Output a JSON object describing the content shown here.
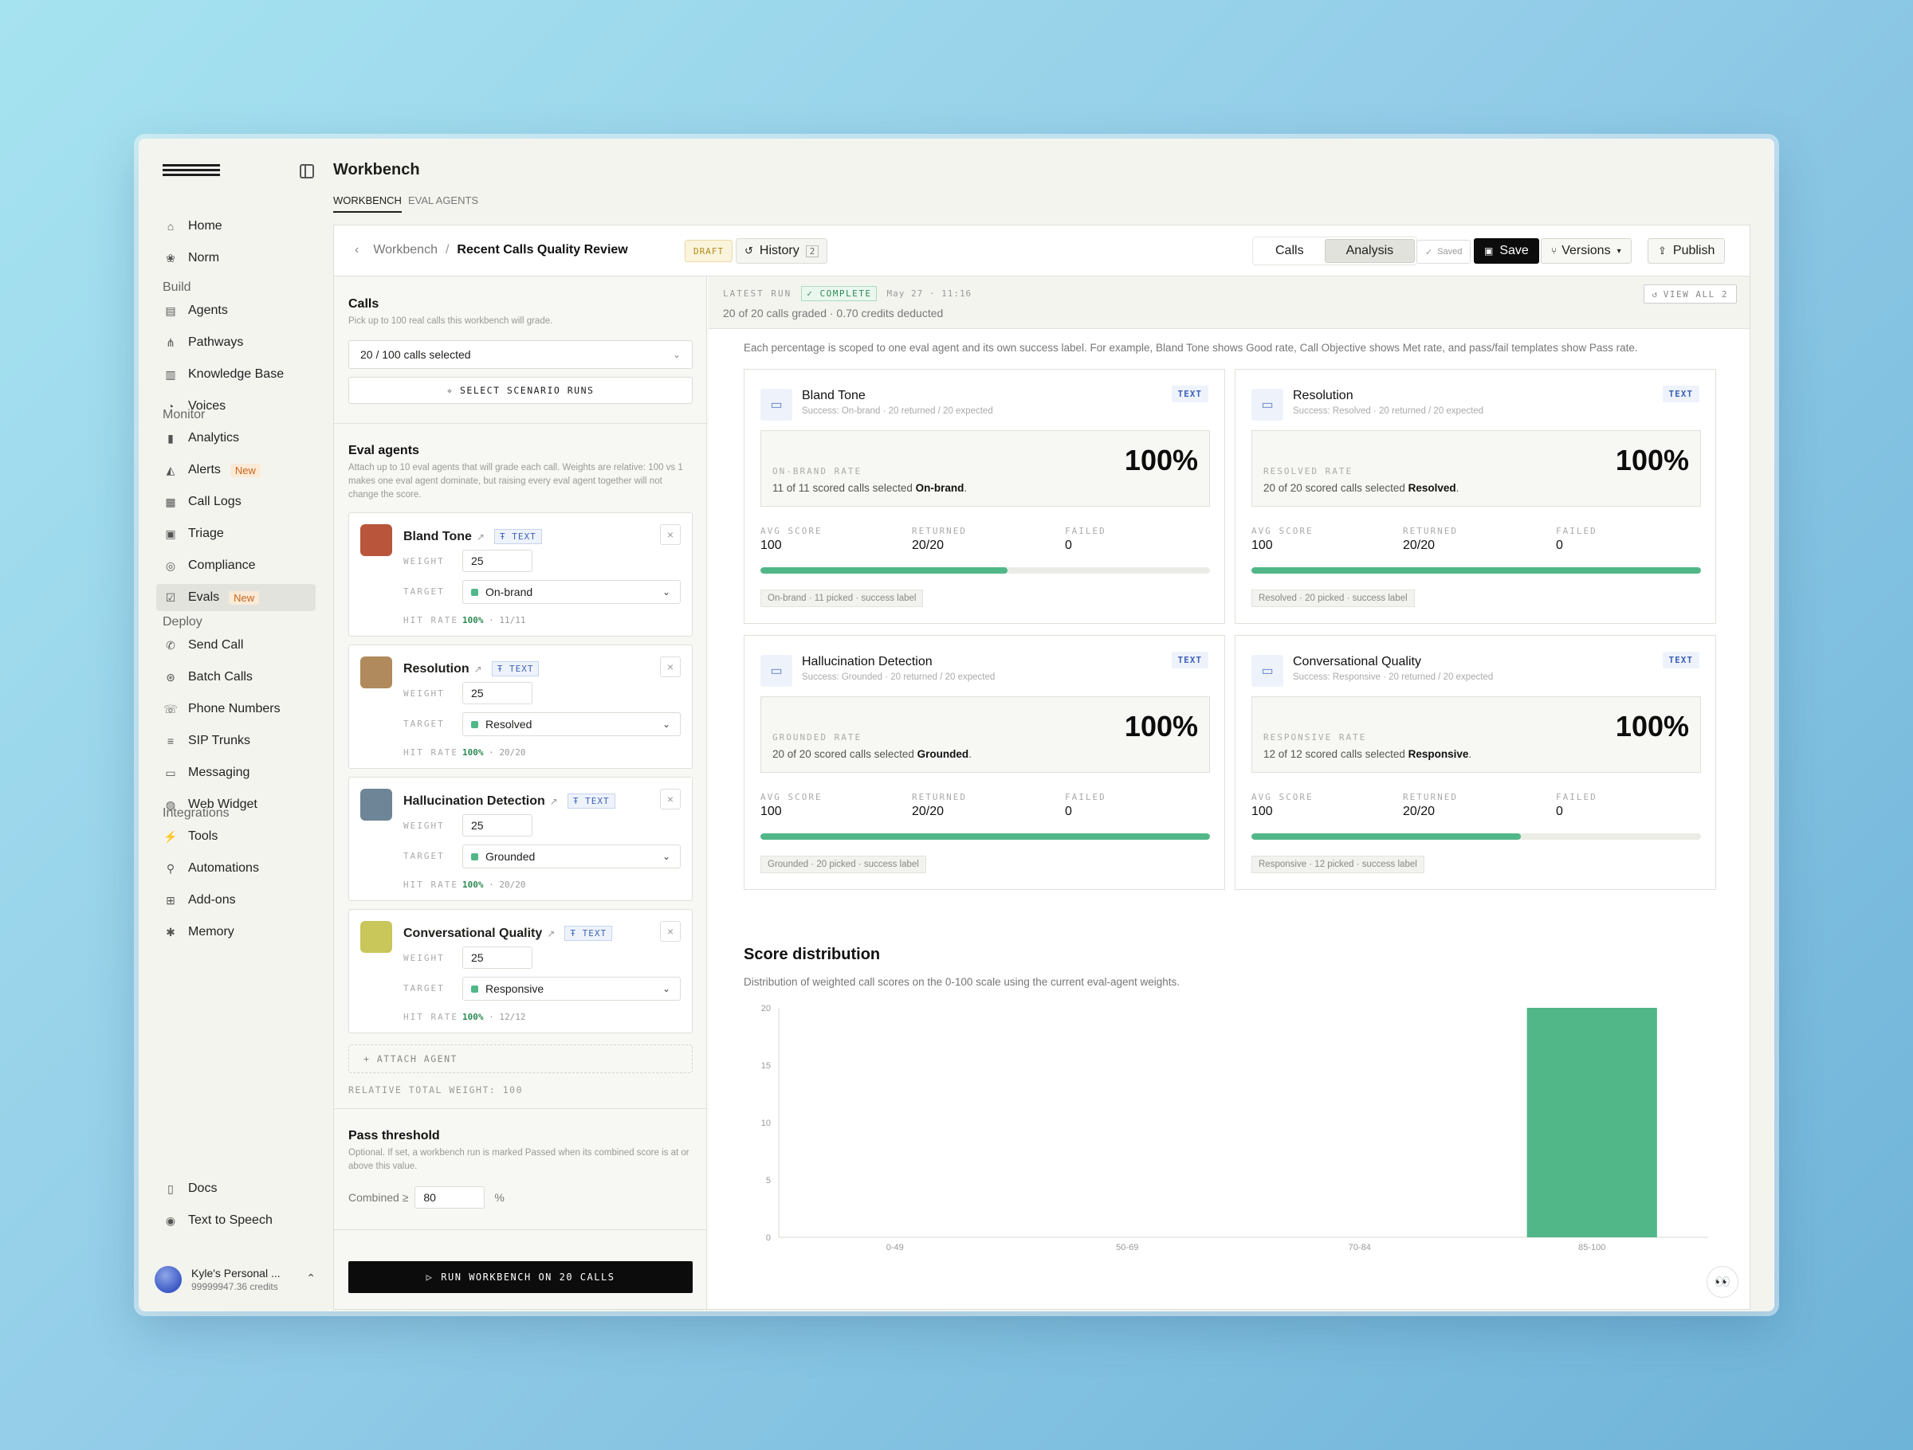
{
  "sidebar": {
    "items": [
      {
        "label": "Home",
        "icon": "home-icon"
      },
      {
        "label": "Norm",
        "icon": "norm-icon"
      }
    ],
    "sections": [
      {
        "title": "Build",
        "items": [
          {
            "label": "Agents"
          },
          {
            "label": "Pathways"
          },
          {
            "label": "Knowledge Base"
          },
          {
            "label": "Voices"
          }
        ]
      },
      {
        "title": "Monitor",
        "items": [
          {
            "label": "Analytics"
          },
          {
            "label": "Alerts",
            "badge": "New"
          },
          {
            "label": "Call Logs"
          },
          {
            "label": "Triage"
          },
          {
            "label": "Compliance"
          },
          {
            "label": "Evals",
            "badge": "New"
          }
        ]
      },
      {
        "title": "Deploy",
        "items": [
          {
            "label": "Send Call"
          },
          {
            "label": "Batch Calls"
          },
          {
            "label": "Phone Numbers"
          },
          {
            "label": "SIP Trunks"
          },
          {
            "label": "Messaging"
          },
          {
            "label": "Web Widget"
          }
        ]
      },
      {
        "title": "Integrations",
        "items": [
          {
            "label": "Tools"
          },
          {
            "label": "Automations"
          },
          {
            "label": "Add-ons"
          },
          {
            "label": "Memory"
          }
        ]
      }
    ],
    "bottom": [
      {
        "label": "Docs"
      },
      {
        "label": "Text to Speech"
      }
    ],
    "user": {
      "name": "Kyle's Personal ...",
      "credits": "99999947.36 credits"
    }
  },
  "header": {
    "title": "Workbench",
    "tabs": [
      {
        "label": "WORKBENCH"
      },
      {
        "label": "EVAL AGENTS"
      }
    ]
  },
  "topbar": {
    "crumb_parent": "Workbench",
    "crumb_sep": "/",
    "crumb_current": "Recent Calls Quality Review",
    "draft": "DRAFT",
    "history_label": "History",
    "history_count": "2",
    "seg_calls": "Calls",
    "seg_analysis": "Analysis",
    "saved": "Saved",
    "save": "Save",
    "versions": "Versions",
    "publish": "Publish"
  },
  "calls": {
    "title": "Calls",
    "sub": "Pick up to 100 real calls this workbench will grade.",
    "selected": "20 / 100 calls selected",
    "scenario_btn": "SELECT SCENARIO RUNS"
  },
  "eval_agents": {
    "title": "Eval agents",
    "sub": "Attach up to 10 eval agents that will grade each call. Weights are relative: 100 vs 1 makes one eval agent dominate, but raising every eval agent together will not change the score.",
    "weight_label": "WEIGHT",
    "target_label": "TARGET",
    "hitrate_label": "HIT RATE",
    "text_tag": "TEXT",
    "agents": [
      {
        "name": "Bland Tone",
        "weight": "25",
        "target": "On-brand",
        "hit": "100%",
        "hit_frac": "· 11/11",
        "color": "#b8553a"
      },
      {
        "name": "Resolution",
        "weight": "25",
        "target": "Resolved",
        "hit": "100%",
        "hit_frac": "· 20/20",
        "color": "#b08a5c"
      },
      {
        "name": "Hallucination Detection",
        "weight": "25",
        "target": "Grounded",
        "hit": "100%",
        "hit_frac": "· 20/20",
        "color": "#6d8596"
      },
      {
        "name": "Conversational Quality",
        "weight": "25",
        "target": "Responsive",
        "hit": "100%",
        "hit_frac": "· 12/12",
        "color": "#c9c65a"
      }
    ],
    "attach": "+ ATTACH AGENT",
    "relative_total": "RELATIVE TOTAL WEIGHT: 100"
  },
  "threshold": {
    "title": "Pass threshold",
    "sub": "Optional. If set, a workbench run is marked Passed when its combined score is at or above this value.",
    "label": "Combined ≥",
    "value": "80",
    "unit": "%"
  },
  "run_button": "RUN WORKBENCH ON 20 CALLS",
  "latest_run": {
    "label": "LATEST RUN",
    "status": "COMPLETE",
    "date": "May 27 · 11:16",
    "summary": "20 of 20 calls graded · 0.70 credits deducted",
    "view_all": "VIEW ALL 2"
  },
  "scope_note": "Each percentage is scoped to one eval agent and its own success label. For example, Bland Tone shows Good rate, Call Objective shows Met rate, and pass/fail templates show Pass rate.",
  "metric_labels": {
    "avg": "AVG SCORE",
    "returned": "RETURNED",
    "failed": "FAILED"
  },
  "cards": [
    {
      "title": "Bland Tone",
      "tag": "TEXT",
      "sub": "Success: On-brand · 20 returned / 20 expected",
      "rate_label": "ON-BRAND RATE",
      "rate": "100%",
      "rate_pre": "11 of 11 scored calls selected ",
      "rate_bold": "On-brand",
      "rate_post": ".",
      "avg": "100",
      "returned": "20/20",
      "failed": "0",
      "progress": 0.55,
      "foot": "On-brand · 11 picked · success label"
    },
    {
      "title": "Resolution",
      "tag": "TEXT",
      "sub": "Success: Resolved · 20 returned / 20 expected",
      "rate_label": "RESOLVED RATE",
      "rate": "100%",
      "rate_pre": "20 of 20 scored calls selected ",
      "rate_bold": "Resolved",
      "rate_post": ".",
      "avg": "100",
      "returned": "20/20",
      "failed": "0",
      "progress": 1.0,
      "foot": "Resolved · 20 picked · success label"
    },
    {
      "title": "Hallucination Detection",
      "tag": "TEXT",
      "sub": "Success: Grounded · 20 returned / 20 expected",
      "rate_label": "GROUNDED RATE",
      "rate": "100%",
      "rate_pre": "20 of 20 scored calls selected ",
      "rate_bold": "Grounded",
      "rate_post": ".",
      "avg": "100",
      "returned": "20/20",
      "failed": "0",
      "progress": 1.0,
      "foot": "Grounded · 20 picked · success label"
    },
    {
      "title": "Conversational Quality",
      "tag": "TEXT",
      "sub": "Success: Responsive · 20 returned / 20 expected",
      "rate_label": "RESPONSIVE RATE",
      "rate": "100%",
      "rate_pre": "12 of 12 scored calls selected ",
      "rate_bold": "Responsive",
      "rate_post": ".",
      "avg": "100",
      "returned": "20/20",
      "failed": "0",
      "progress": 0.6,
      "foot": "Responsive · 12 picked · success label"
    }
  ],
  "score_dist": {
    "title": "Score distribution",
    "sub": "Distribution of weighted call scores on the 0-100 scale using the current eval-agent weights."
  },
  "chart_data": {
    "type": "bar",
    "categories": [
      "0-49",
      "50-69",
      "70-84",
      "85-100"
    ],
    "values": [
      0,
      0,
      0,
      20
    ],
    "ylim": [
      0,
      20
    ],
    "yticks": [
      0,
      5,
      10,
      15,
      20
    ],
    "color": "#52b788",
    "grid": false
  }
}
